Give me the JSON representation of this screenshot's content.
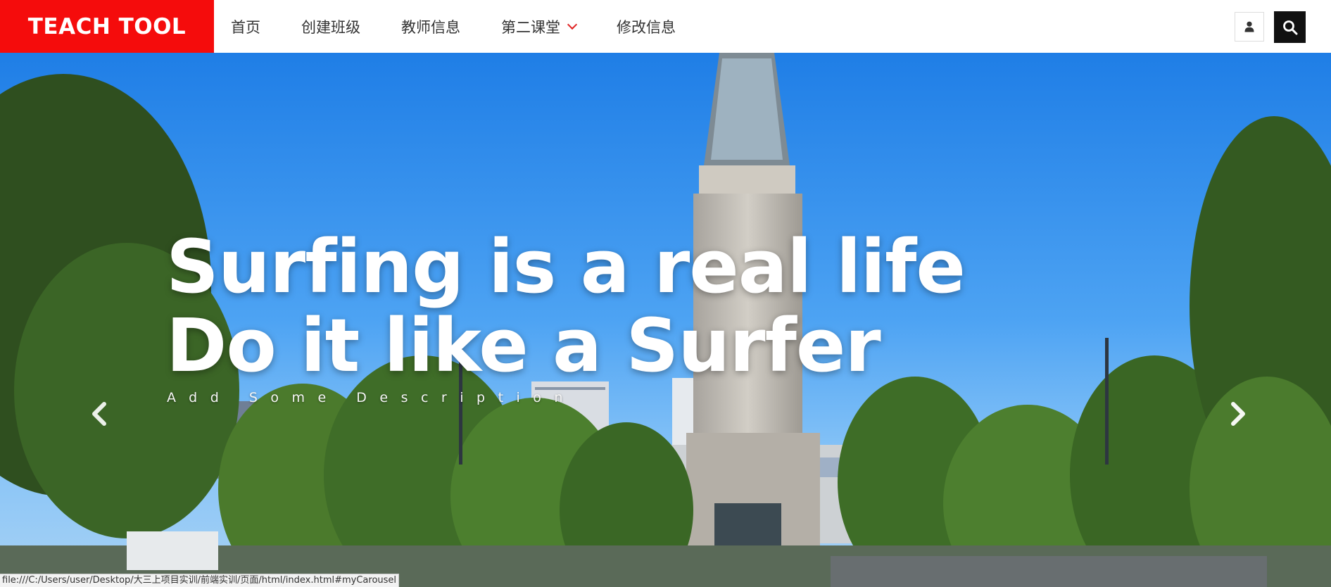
{
  "brand": {
    "label": "TEACH TOOL",
    "color": "#f50c0c"
  },
  "nav": {
    "items": [
      {
        "label": "首页"
      },
      {
        "label": "创建班级"
      },
      {
        "label": "教师信息"
      },
      {
        "label": "第二课堂",
        "has_dropdown": true
      },
      {
        "label": "修改信息"
      }
    ],
    "user_icon": "user-icon",
    "search_icon": "search-icon"
  },
  "hero": {
    "title_line1": "Surfing is a real life",
    "title_line2": "Do it like a Surfer",
    "description": "Add Some Description",
    "prev_icon": "chevron-left-icon",
    "next_icon": "chevron-right-icon"
  },
  "status_bar": {
    "url": "file:///C:/Users/user/Desktop/大三上项目实训/前端实训/页面/html/index.html#myCarousel"
  }
}
